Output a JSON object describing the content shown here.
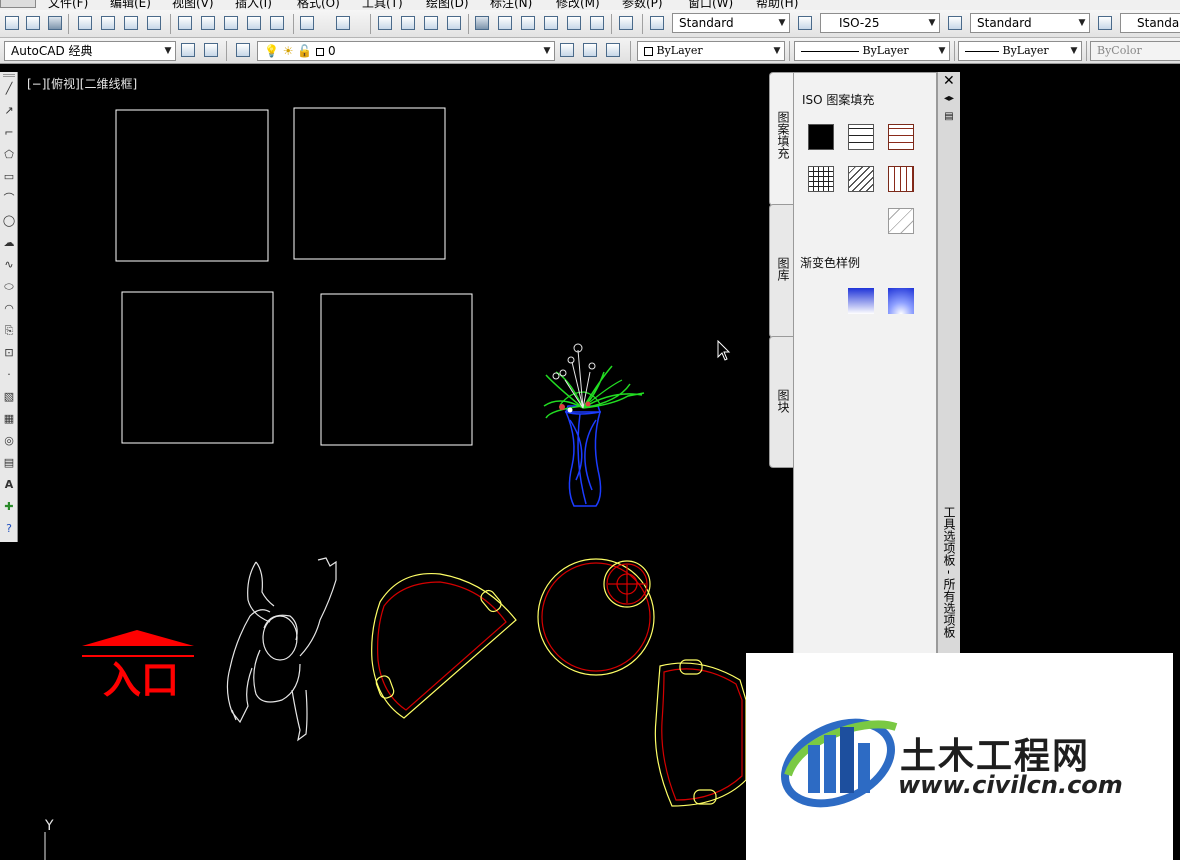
{
  "menu": [
    "文件(F)",
    "编辑(E)",
    "视图(V)",
    "插入(I)",
    "格式(O)",
    "工具(T)",
    "绘图(D)",
    "标注(N)",
    "修改(M)",
    "参数(P)",
    "窗口(W)",
    "帮助(H)"
  ],
  "toolbar_top": {
    "text_style": "Standard",
    "dim_style": "ISO-25",
    "table_style": "Standard",
    "multileader_style": "Standard"
  },
  "toolbar_second": {
    "workspace": "AutoCAD 经典",
    "layer": "0",
    "color": "ByLayer",
    "linetype": "ByLayer",
    "lineweight": "ByLayer",
    "plotstyle": "ByColor"
  },
  "viewport": {
    "label": "[−][俯视][二维线框]",
    "ucs_y_label": "Y",
    "entrance_text": "入口"
  },
  "palette": {
    "section_title": "ISO 图案填充",
    "gradient_title": "渐变色样例",
    "tabs": [
      "图案填充",
      "图库",
      "图块"
    ],
    "side_title": "工具选项板 - 所有选项板",
    "close_glyph": "✕",
    "hatch_swatches": [
      "solid-fill",
      "brick-pattern",
      "brick-red-pattern",
      "grid-pattern",
      "ansi31-pattern",
      "ar-parq-pattern",
      "ansi31-light-pattern"
    ],
    "gradient_swatches": [
      "gradient-blue-linear",
      "gradient-blue-radial"
    ]
  },
  "watermark": {
    "name": "土木工程网",
    "url": "www.civilcn.com"
  },
  "colors": {
    "canvas": "#000000",
    "line_white": "#ffffff",
    "line_yellow": "#ffff66",
    "line_red": "#d40000",
    "plant_green": "#22dd22",
    "vase_blue": "#1c3cff"
  }
}
